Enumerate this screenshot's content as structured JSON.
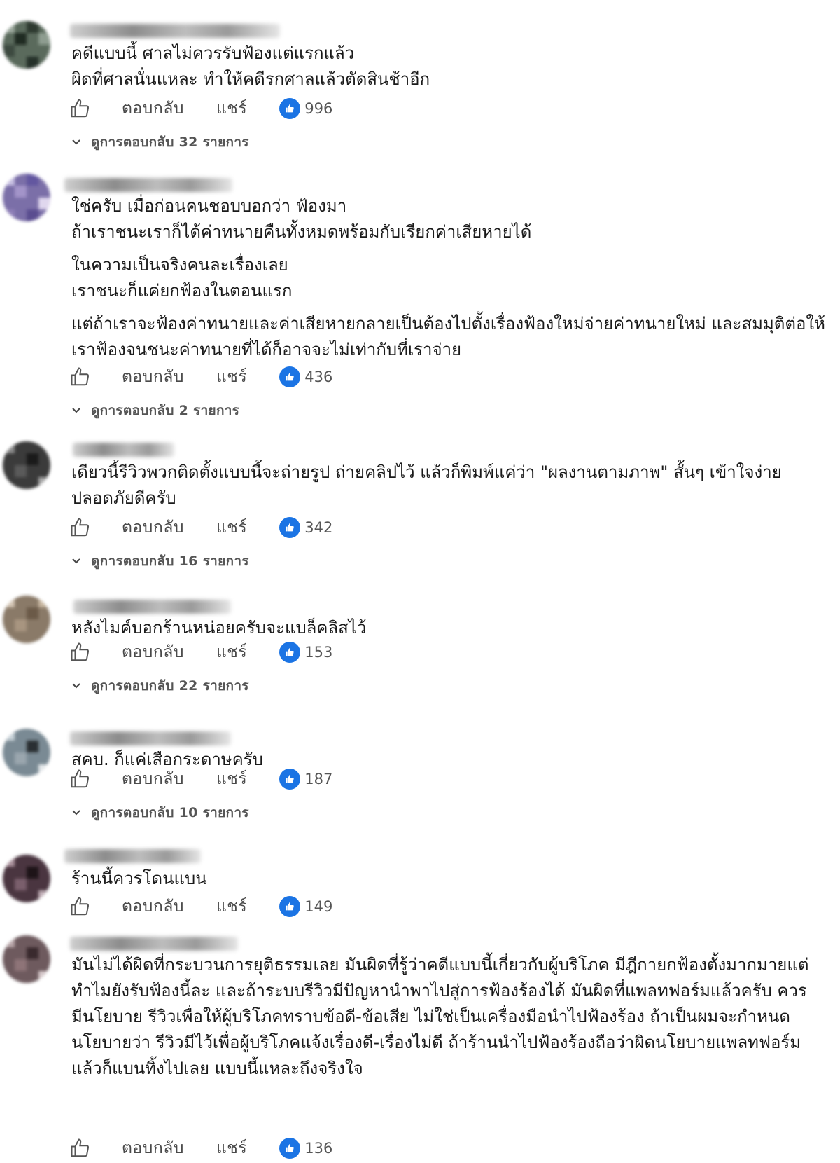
{
  "actions": {
    "reply_label": "ตอบกลับ",
    "share_label": "แชร์"
  },
  "comments": [
    {
      "paragraphs": [
        "คดีแบบนี้ ศาลไม่ควรรับฟ้องแต่แรกแล้ว\nผิดที่ศาลนั่นแหละ ทำให้คดีรกศาลแล้วตัดสินช้าอีก"
      ],
      "reactions": "996",
      "replies": "ดูการตอบกลับ 32 รายการ"
    },
    {
      "paragraphs": [
        "ใช่ครับ เมื่อก่อนคนชอบบอกว่า ฟ้องมา\nถ้าเราชนะเราก็ได้ค่าทนายคืนทั้งหมดพร้อมกับเรียกค่าเสียหายได้",
        "ในความเป็นจริงคนละเรื่องเลย\nเราชนะก็แค่ยกฟ้องในตอนแรก",
        "แต่ถ้าเราจะฟ้องค่าทนายและค่าเสียหายกลายเป็นต้องไปตั้งเรื่องฟ้องใหม่จ่ายค่าทนายใหม่ และสมมุติต่อให้เราฟ้องจนชนะค่าทนายที่ได้ก็อาจจะไม่เท่ากับที่เราจ่าย"
      ],
      "reactions": "436",
      "replies": "ดูการตอบกลับ 2 รายการ"
    },
    {
      "paragraphs": [
        "เดียวนี้รีวิวพวกติดตั้งแบบนี้จะถ่ายรูป ถ่ายคลิปไว้ แล้วก็พิมพ์แค่ว่า \"ผลงานตามภาพ\" สั้นๆ เข้าใจง่าย ปลอดภัยดีครับ"
      ],
      "reactions": "342",
      "replies": "ดูการตอบกลับ 16 รายการ"
    },
    {
      "paragraphs": [
        "หลังไมค์บอกร้านหน่อยครับจะแบล็คลิสไว้"
      ],
      "reactions": "153",
      "replies": "ดูการตอบกลับ 22 รายการ"
    },
    {
      "paragraphs": [
        "สคบ. ก็แค่เสือกระดาษครับ"
      ],
      "reactions": "187",
      "replies": "ดูการตอบกลับ 10 รายการ"
    },
    {
      "paragraphs": [
        "ร้านนี้ควรโดนแบน"
      ],
      "reactions": "149",
      "replies": ""
    },
    {
      "paragraphs": [
        "มันไม่ได้ผิดที่กระบวนการยุติธรรมเลย มันผิดที่รู้ว่าคดีแบบนี้เกี่ยวกับผู้บริโภค มีฎีกายกฟ้องตั้งมากมายแต่ทำไมยังรับฟ้องนี้ละ และถ้าระบบรีวิวมีปัญหานำพาไปสู่การฟ้องร้องได้ มันผิดที่แพลทฟอร์มแล้วครับ ควรมีนโยบาย รีวิวเพื่อให้ผู้บริโภคทราบข้อดี-ข้อเสีย ไม่ใช่เป็นเครื่องมือนำไปฟ้องร้อง ถ้าเป็นผมจะกำหนดนโยบายว่า รีวิวมีไว้เพื่อผู้บริโภคแจ้งเรื่องดี-เรื่องไม่ดี ถ้าร้านนำไปฟ้องร้องถือว่าผิดนโยบายแพลทฟอร์ม แล้วก็แบนทิ้งไปเลย แบบนี้แหละถึงจริงใจ"
      ],
      "reactions": "136",
      "replies": ""
    }
  ]
}
